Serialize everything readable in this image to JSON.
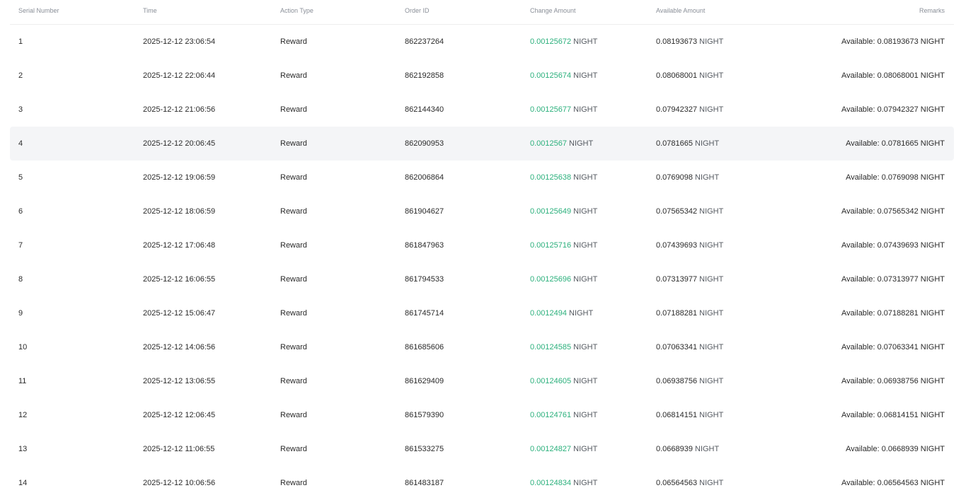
{
  "table": {
    "headers": {
      "serial": "Serial Number",
      "time": "Time",
      "action": "Action Type",
      "order": "Order ID",
      "change": "Change Amount",
      "available": "Available Amount",
      "remarks": "Remarks"
    },
    "unit": "NIGHT",
    "remarks_prefix": "Available:",
    "rows": [
      {
        "serial": "1",
        "time": "2025-12-12 23:06:54",
        "action": "Reward",
        "order": "862237264",
        "change": "0.00125672",
        "available": "0.08193673",
        "remarks": "Available: 0.08193673 NIGHT"
      },
      {
        "serial": "2",
        "time": "2025-12-12 22:06:44",
        "action": "Reward",
        "order": "862192858",
        "change": "0.00125674",
        "available": "0.08068001",
        "remarks": "Available: 0.08068001 NIGHT"
      },
      {
        "serial": "3",
        "time": "2025-12-12 21:06:56",
        "action": "Reward",
        "order": "862144340",
        "change": "0.00125677",
        "available": "0.07942327",
        "remarks": "Available: 0.07942327 NIGHT"
      },
      {
        "serial": "4",
        "time": "2025-12-12 20:06:45",
        "action": "Reward",
        "order": "862090953",
        "change": "0.0012567",
        "available": "0.0781665",
        "remarks": "Available: 0.0781665 NIGHT",
        "highlight": true
      },
      {
        "serial": "5",
        "time": "2025-12-12 19:06:59",
        "action": "Reward",
        "order": "862006864",
        "change": "0.00125638",
        "available": "0.0769098",
        "remarks": "Available: 0.0769098 NIGHT"
      },
      {
        "serial": "6",
        "time": "2025-12-12 18:06:59",
        "action": "Reward",
        "order": "861904627",
        "change": "0.00125649",
        "available": "0.07565342",
        "remarks": "Available: 0.07565342 NIGHT"
      },
      {
        "serial": "7",
        "time": "2025-12-12 17:06:48",
        "action": "Reward",
        "order": "861847963",
        "change": "0.00125716",
        "available": "0.07439693",
        "remarks": "Available: 0.07439693 NIGHT"
      },
      {
        "serial": "8",
        "time": "2025-12-12 16:06:55",
        "action": "Reward",
        "order": "861794533",
        "change": "0.00125696",
        "available": "0.07313977",
        "remarks": "Available: 0.07313977 NIGHT"
      },
      {
        "serial": "9",
        "time": "2025-12-12 15:06:47",
        "action": "Reward",
        "order": "861745714",
        "change": "0.0012494",
        "available": "0.07188281",
        "remarks": "Available: 0.07188281 NIGHT"
      },
      {
        "serial": "10",
        "time": "2025-12-12 14:06:56",
        "action": "Reward",
        "order": "861685606",
        "change": "0.00124585",
        "available": "0.07063341",
        "remarks": "Available: 0.07063341 NIGHT"
      },
      {
        "serial": "11",
        "time": "2025-12-12 13:06:55",
        "action": "Reward",
        "order": "861629409",
        "change": "0.00124605",
        "available": "0.06938756",
        "remarks": "Available: 0.06938756 NIGHT"
      },
      {
        "serial": "12",
        "time": "2025-12-12 12:06:45",
        "action": "Reward",
        "order": "861579390",
        "change": "0.00124761",
        "available": "0.06814151",
        "remarks": "Available: 0.06814151 NIGHT"
      },
      {
        "serial": "13",
        "time": "2025-12-12 11:06:55",
        "action": "Reward",
        "order": "861533275",
        "change": "0.00124827",
        "available": "0.0668939",
        "remarks": "Available: 0.0668939 NIGHT"
      },
      {
        "serial": "14",
        "time": "2025-12-12 10:06:56",
        "action": "Reward",
        "order": "861483187",
        "change": "0.00124834",
        "available": "0.06564563",
        "remarks": "Available: 0.06564563 NIGHT"
      }
    ]
  },
  "colors": {
    "positive": "#2bb07c",
    "header_text": "#8a8f98",
    "row_highlight": "#f4f5f7"
  }
}
